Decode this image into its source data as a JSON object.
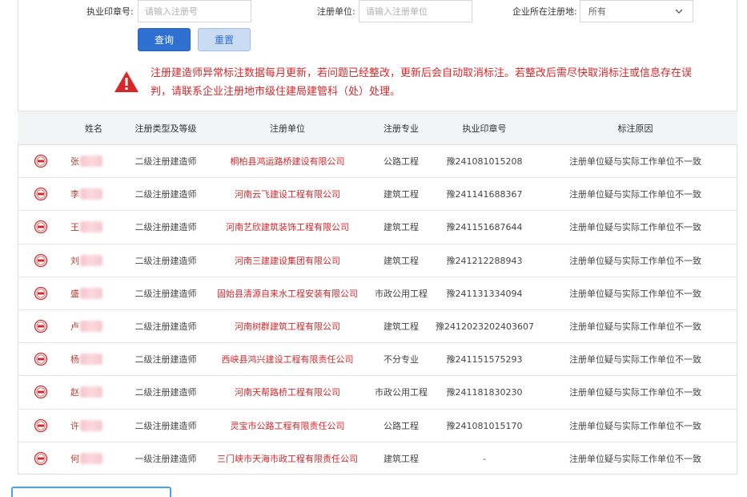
{
  "search": {
    "seal_label": "执业印章号:",
    "seal_placeholder": "请输入注册号",
    "unit_label": "注册单位:",
    "unit_placeholder": "请输入注册单位",
    "region_label": "企业所在注册地:",
    "region_value": "所有",
    "query_label": "查询",
    "reset_label": "重置"
  },
  "notice": {
    "text": "注册建造师异常标注数据每月更新，若问题已经整改，更新后会自动取消标注。若整改后需尽快取消标注或信息存在误判，请联系企业注册地市级住建局建管科（处）处理。"
  },
  "table": {
    "headers": [
      "",
      "姓名",
      "注册类型及等级",
      "注册单位",
      "注册专业",
      "执业印章号",
      "标注原因"
    ],
    "rows": [
      {
        "name": "张",
        "type": "二级注册建造师",
        "company": "桐柏县鸿运路桥建设有限公司",
        "major": "公路工程",
        "seal": "豫241081015208",
        "reason": "注册单位疑与实际工作单位不一致"
      },
      {
        "name": "李",
        "type": "二级注册建造师",
        "company": "河南云飞建设工程有限公司",
        "major": "建筑工程",
        "seal": "豫241141688367",
        "reason": "注册单位疑与实际工作单位不一致"
      },
      {
        "name": "王",
        "type": "二级注册建造师",
        "company": "河南艺欣建筑装饰工程有限公司",
        "major": "建筑工程",
        "seal": "豫241151687644",
        "reason": "注册单位疑与实际工作单位不一致"
      },
      {
        "name": "刘",
        "type": "二级注册建造师",
        "company": "河南三建建设集团有限公司",
        "major": "建筑工程",
        "seal": "豫241212288943",
        "reason": "注册单位疑与实际工作单位不一致"
      },
      {
        "name": "盛",
        "type": "二级注册建造师",
        "company": "固始县清源自来水工程安装有限公司",
        "major": "市政公用工程",
        "seal": "豫241131334094",
        "reason": "注册单位疑与实际工作单位不一致"
      },
      {
        "name": "卢",
        "type": "二级注册建造师",
        "company": "河南树群建筑工程有限公司",
        "major": "建筑工程",
        "seal": "豫2412023202403607",
        "reason": "注册单位疑与实际工作单位不一致"
      },
      {
        "name": "杨",
        "type": "二级注册建造师",
        "company": "西峡县鸿兴建设工程有限责任公司",
        "major": "不分专业",
        "seal": "豫241151575293",
        "reason": "注册单位疑与实际工作单位不一致"
      },
      {
        "name": "赵",
        "type": "二级注册建造师",
        "company": "河南天帮路桥工程有限公司",
        "major": "市政公用工程",
        "seal": "豫241181830230",
        "reason": "注册单位疑与实际工作单位不一致"
      },
      {
        "name": "许",
        "type": "二级注册建造师",
        "company": "灵宝市公路工程有限责任公司",
        "major": "公路工程",
        "seal": "豫241081015170",
        "reason": "注册单位疑与实际工作单位不一致"
      },
      {
        "name": "何",
        "type": "一级注册建造师",
        "company": "三门峡市天海市政工程有限责任公司",
        "major": "建筑工程",
        "seal": "-",
        "reason": "注册单位疑与实际工作单位不一致"
      }
    ]
  },
  "colors": {
    "primary": "#2f6fcf",
    "danger": "#d6282b",
    "header_bg": "#f3f4f6"
  }
}
